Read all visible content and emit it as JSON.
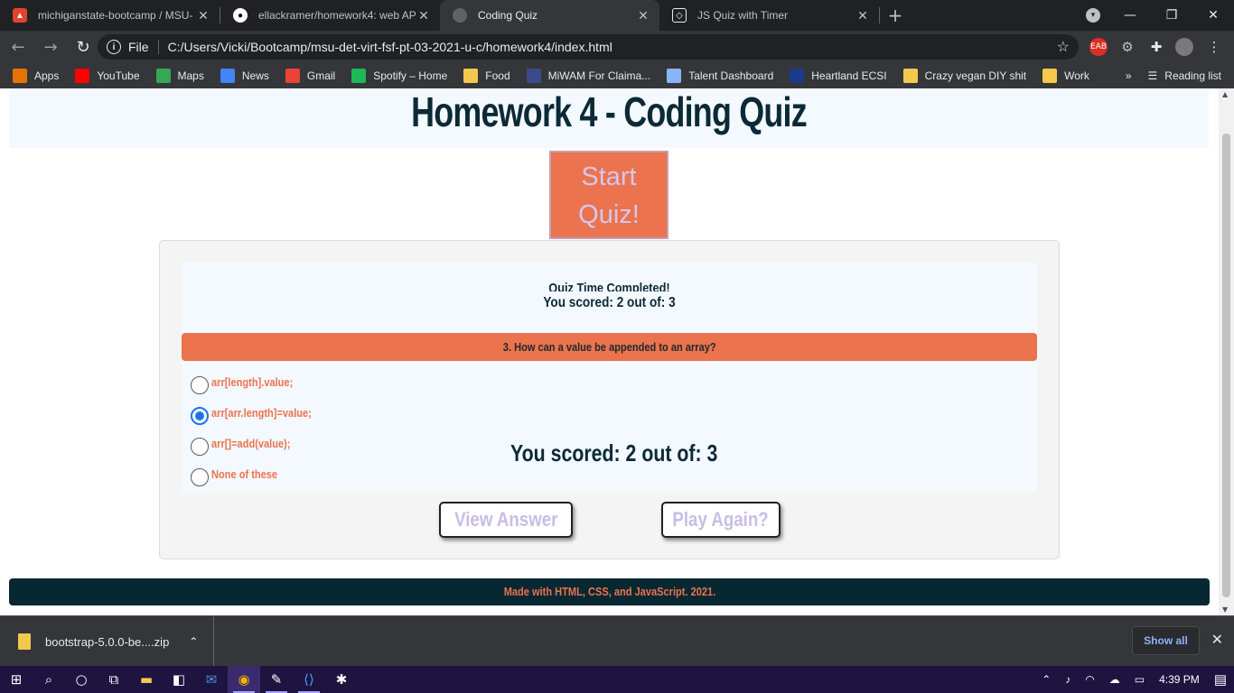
{
  "browser": {
    "tabs": [
      {
        "title": "michiganstate-bootcamp / MSU-",
        "active": false
      },
      {
        "title": "ellackramer/homework4: web AP",
        "active": false
      },
      {
        "title": "Coding Quiz",
        "active": true
      },
      {
        "title": "JS Quiz with Timer",
        "active": false
      }
    ],
    "address": {
      "scheme_label": "File",
      "url": "C:/Users/Vicki/Bootcamp/msu-det-virt-fsf-pt-03-2021-u-c/homework4/index.html"
    },
    "bookmarks": [
      {
        "label": "Apps",
        "icon": "apps-grid-icon",
        "color": "#e37400"
      },
      {
        "label": "YouTube",
        "icon": "youtube-icon",
        "color": "#ff0000"
      },
      {
        "label": "Maps",
        "icon": "maps-pin-icon",
        "color": "#34a853"
      },
      {
        "label": "News",
        "icon": "news-icon",
        "color": "#4285f4"
      },
      {
        "label": "Gmail",
        "icon": "gmail-icon",
        "color": "#ea4335"
      },
      {
        "label": "Spotify – Home",
        "icon": "spotify-icon",
        "color": "#1db954"
      },
      {
        "label": "Food",
        "icon": "folder-icon",
        "color": "#f2c94c"
      },
      {
        "label": "MiWAM For Claima...",
        "icon": "miwam-icon",
        "color": "#3c4a8a"
      },
      {
        "label": "Talent Dashboard",
        "icon": "document-icon",
        "color": "#8ab4f8"
      },
      {
        "label": "Heartland ECSI",
        "icon": "heartland-icon",
        "color": "#1a3a8a"
      },
      {
        "label": "Crazy vegan DIY shit",
        "icon": "folder-icon",
        "color": "#f2c94c"
      },
      {
        "label": "Work",
        "icon": "folder-icon",
        "color": "#f2c94c"
      }
    ],
    "bookmarks_overflow": "»",
    "reading_list": "Reading list"
  },
  "page": {
    "title": "Homework 4 - Coding Quiz",
    "start_button": "Start Quiz!",
    "quiz": {
      "completed_title": "Quiz Time Completed!",
      "score_line": "You scored: 2 out of: 3",
      "question": "3. How can a value be appended to an array?",
      "options": [
        {
          "label": "arr[length].value;",
          "checked": false
        },
        {
          "label": "arr[arr.length]=value;",
          "checked": true
        },
        {
          "label": "arr[]=add(value);",
          "checked": false
        },
        {
          "label": "None of these",
          "checked": false
        }
      ],
      "final_score": "You scored: 2 out of: 3"
    },
    "view_answer_button": "View Answer",
    "play_again_button": "Play Again?",
    "footer": "Made with HTML, CSS, and JavaScript. 2021."
  },
  "downloads": {
    "file": "bootstrap-5.0.0-be....zip",
    "show_all": "Show all"
  },
  "taskbar": {
    "time": "4:39 PM"
  },
  "colors": {
    "accent": "#eb734d",
    "heading": "#0a2a36",
    "footer_bg": "#072733",
    "button_text": "#c9bde6"
  }
}
